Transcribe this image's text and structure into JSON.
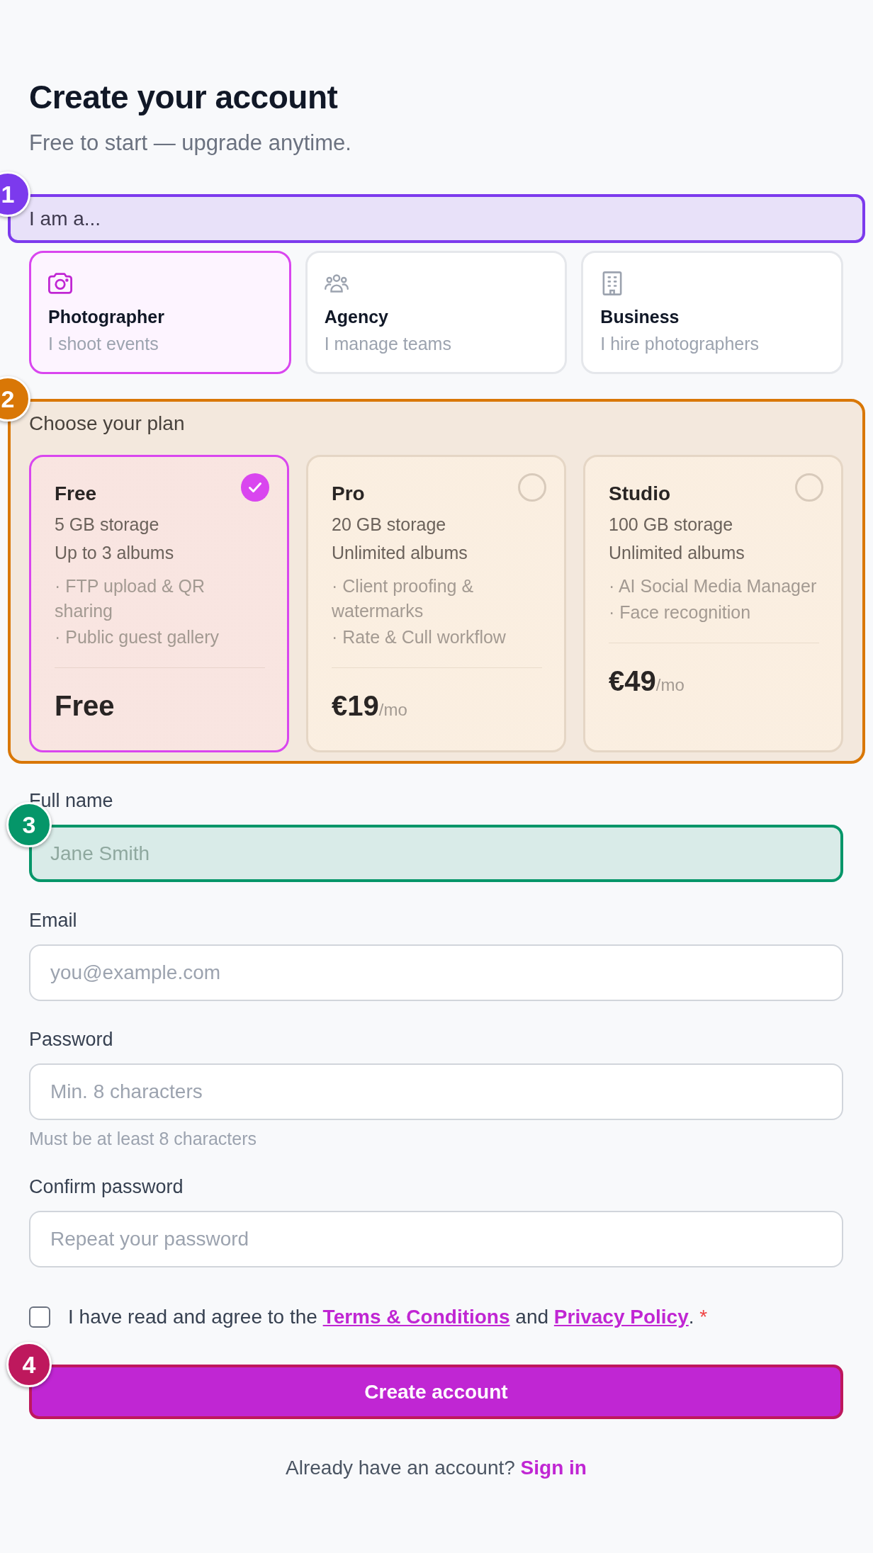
{
  "header": {
    "title": "Create your account",
    "subtitle": "Free to start — upgrade anytime."
  },
  "role_picker": {
    "label": "I am a...",
    "annotation": {
      "number": "1",
      "color": "#7c3aed"
    },
    "options": [
      {
        "kind": "photographer",
        "title": "Photographer",
        "description": "I shoot events",
        "selected": true
      },
      {
        "kind": "agency",
        "title": "Agency",
        "description": "I manage teams",
        "selected": false
      },
      {
        "kind": "business",
        "title": "Business",
        "description": "I hire photographers",
        "selected": false
      }
    ]
  },
  "plans": {
    "label": "Choose your plan",
    "annotation": {
      "number": "2",
      "color": "#d97706"
    },
    "items": [
      {
        "name": "Free",
        "storage": "5 GB storage",
        "albums": "Up to 3 albums",
        "features": [
          "· FTP upload & QR sharing",
          "· Public guest gallery"
        ],
        "price": "Free",
        "selected": true
      },
      {
        "name": "Pro",
        "storage": "20 GB storage",
        "albums": "Unlimited albums",
        "features": [
          "· Client proofing & watermarks",
          "· Rate & Cull workflow"
        ],
        "price": "€19",
        "period": "/mo",
        "selected": false
      },
      {
        "name": "Studio",
        "storage": "100 GB storage",
        "albums": "Unlimited albums",
        "features": [
          "· AI Social Media Manager",
          "· Face recognition"
        ],
        "price": "€49",
        "period": "/mo",
        "selected": false
      }
    ]
  },
  "fields": [
    {
      "label": "Full name",
      "placeholder": "Jane Smith",
      "annotation": {
        "number": "3",
        "color": "#059669"
      }
    },
    {
      "label": "Email",
      "placeholder": "you@example.com"
    },
    {
      "label": "Password",
      "placeholder": "Min. 8 characters",
      "hint": "Must be at least 8 characters"
    },
    {
      "label": "Confirm password",
      "placeholder": "Repeat your password"
    }
  ],
  "agreement": {
    "checked": false,
    "text_before": "I have read and agree to the",
    "terms_link": "Terms & Conditions",
    "joiner": "and",
    "privacy_link": "Privacy Policy",
    "ending": ".",
    "required_mark": "*"
  },
  "submit": {
    "label": "Create account",
    "annotation": {
      "number": "4",
      "color": "#be185d"
    }
  },
  "footer": {
    "prompt": "Already have an account?",
    "link": "Sign in"
  }
}
